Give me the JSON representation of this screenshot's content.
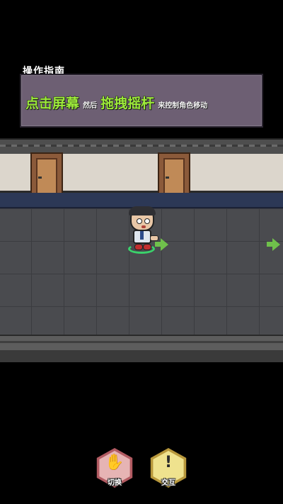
{
  "guide": {
    "title": "操作指南",
    "part1": "点击屏幕",
    "part2": "然后",
    "part3": "拖拽摇杆",
    "part4": "来控制角色移动"
  },
  "buttons": {
    "switch_label": "切换",
    "interact_label": "交互",
    "switch_icon": "hand-icon",
    "interact_icon": "exclamation-icon"
  },
  "colors": {
    "highlight": "#9dea3a",
    "panel": "#6d5f73",
    "arrow": "#6fc04b",
    "ring": "#3ad26b"
  }
}
